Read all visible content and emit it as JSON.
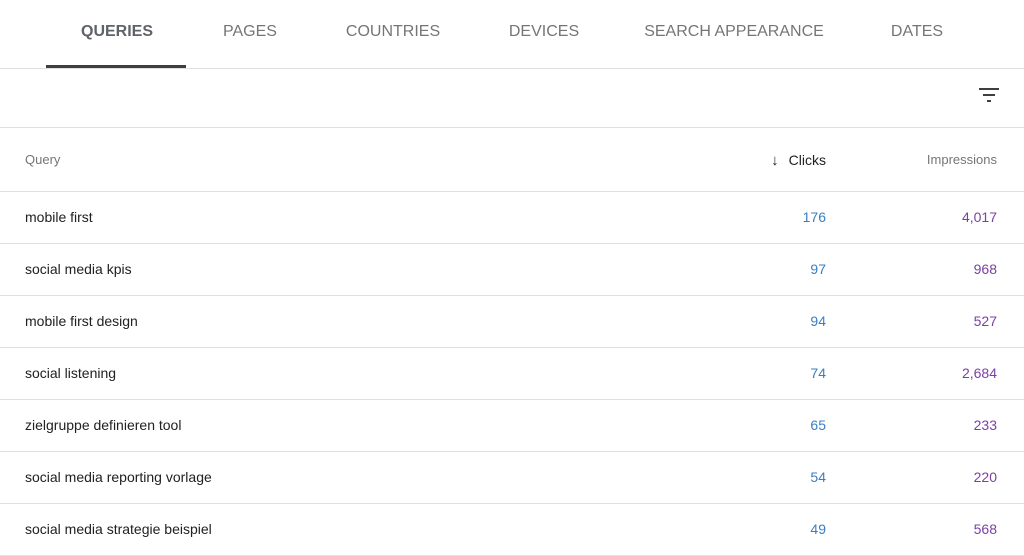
{
  "tabs": [
    {
      "label": "QUERIES",
      "active": true
    },
    {
      "label": "PAGES"
    },
    {
      "label": "COUNTRIES"
    },
    {
      "label": "DEVICES"
    },
    {
      "label": "SEARCH APPEARANCE"
    },
    {
      "label": "DATES"
    }
  ],
  "filter": {
    "icon": "filter-icon"
  },
  "table": {
    "headers": {
      "query": "Query",
      "clicks": "Clicks",
      "impressions": "Impressions",
      "sort_icon": "arrow-down-icon"
    },
    "rows": [
      {
        "query": "mobile first",
        "clicks": "176",
        "impressions": "4,017"
      },
      {
        "query": "social media kpis",
        "clicks": "97",
        "impressions": "968"
      },
      {
        "query": "mobile first design",
        "clicks": "94",
        "impressions": "527"
      },
      {
        "query": "social listening",
        "clicks": "74",
        "impressions": "2,684"
      },
      {
        "query": "zielgruppe definieren tool",
        "clicks": "65",
        "impressions": "233"
      },
      {
        "query": "social media reporting vorlage",
        "clicks": "54",
        "impressions": "220"
      },
      {
        "query": "social media strategie beispiel",
        "clicks": "49",
        "impressions": "568"
      }
    ]
  },
  "colors": {
    "clicks": "#3b7dc4",
    "impressions": "#7b3fa5"
  }
}
